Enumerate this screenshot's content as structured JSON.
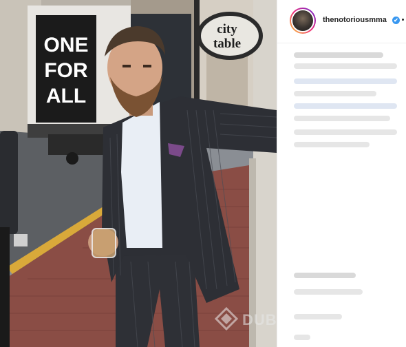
{
  "post": {
    "username": "thenotoriousmma",
    "verified_icon": "✔",
    "more_icon": "more-dots-icon"
  },
  "photo": {
    "truck_sign_lines": [
      "ONE",
      "FOR",
      "ALL"
    ],
    "street_sign_line1": "city",
    "street_sign_line2": "table"
  },
  "watermark": {
    "text": "DUBAIDOLBIL.COM"
  },
  "colors": {
    "verified": "#3897f0",
    "avatar_ring_start": "#f9ce34",
    "avatar_ring_end": "#6228d7",
    "suit": "#2d2f35",
    "shirt": "#e9eef5",
    "brick": "#8a4d45"
  }
}
